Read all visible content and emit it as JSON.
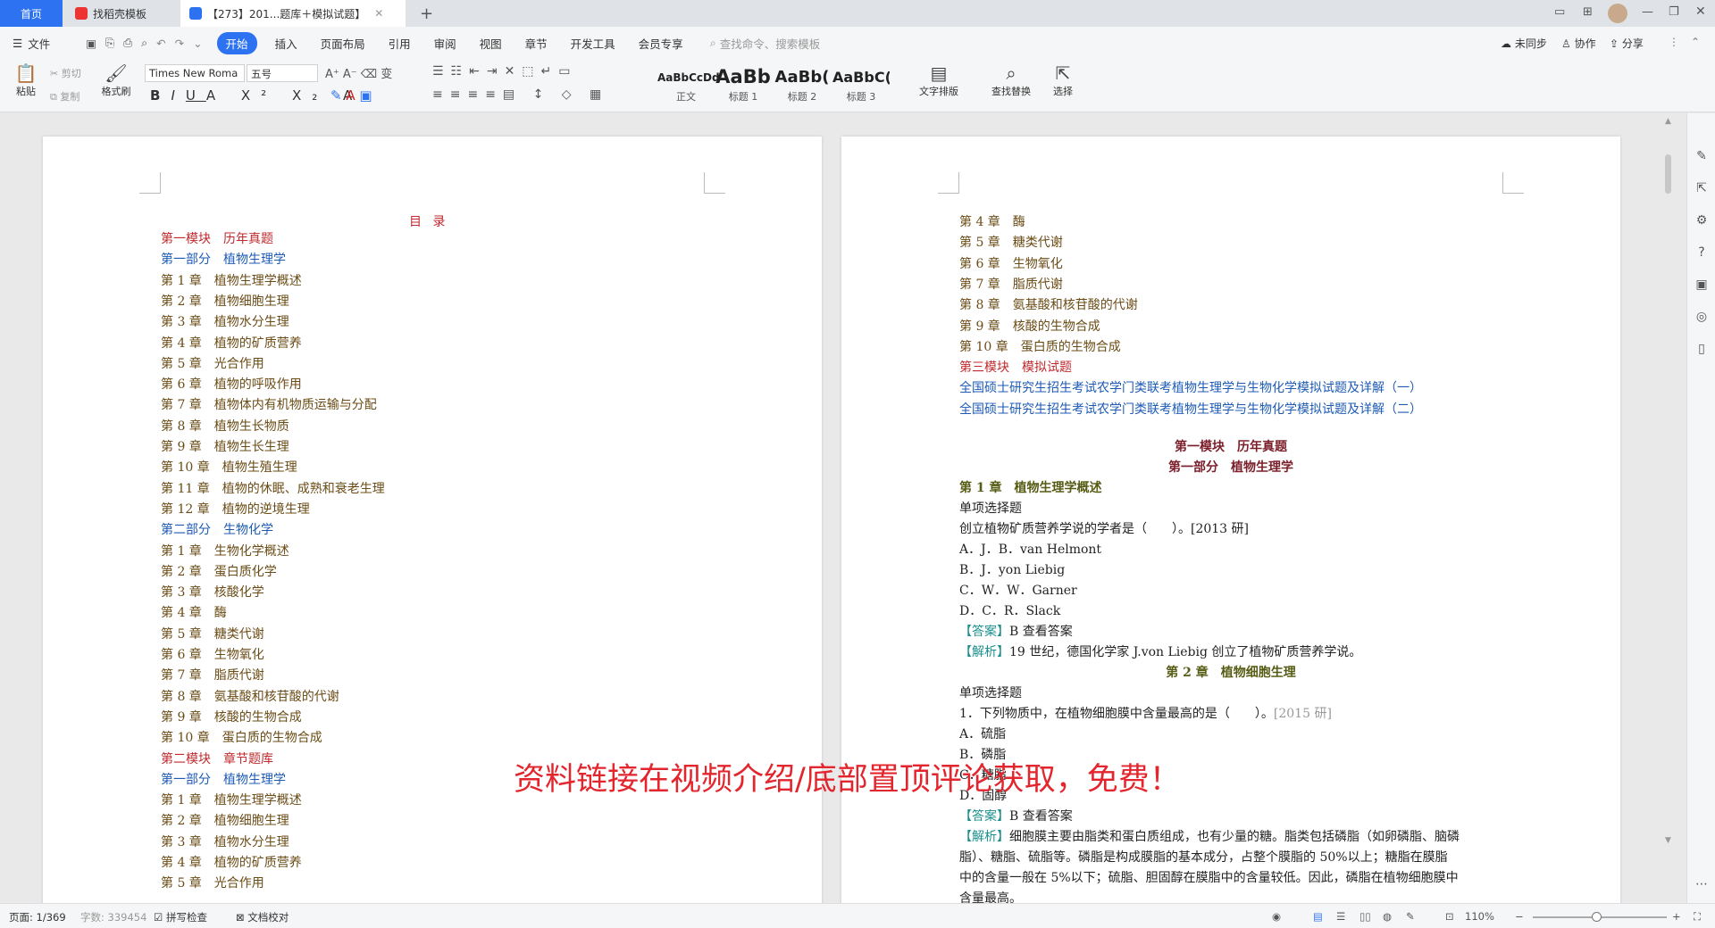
{
  "tabs": {
    "home": "首页",
    "template": "找稻壳模板",
    "doc": "【273】201...题库＋模拟试题】"
  },
  "menu": {
    "file": "文件",
    "items": [
      "开始",
      "插入",
      "页面布局",
      "引用",
      "审阅",
      "视图",
      "章节",
      "开发工具",
      "会员专享"
    ],
    "search": "查找命令、搜索模板",
    "sync": "未同步",
    "collab": "协作",
    "share": "分享"
  },
  "ribbon": {
    "paste": "粘贴",
    "cut": "剪切",
    "copy": "复制",
    "format_painter": "格式刷",
    "font": "Times New Roma",
    "size": "五号",
    "styles": [
      {
        "sample": "AaBbCcDd",
        "label": "正文"
      },
      {
        "sample": "AaBb",
        "label": "标题 1"
      },
      {
        "sample": "AaBb(",
        "label": "标题 2"
      },
      {
        "sample": "AaBbC(",
        "label": "标题 3"
      }
    ],
    "text_layout": "文字排版",
    "find_replace": "查找替换",
    "select": "选择"
  },
  "left_page": {
    "title": "目 录",
    "lines": [
      {
        "t": "第一模块　历年真题",
        "c": "red"
      },
      {
        "t": "第一部分　植物生理学",
        "c": "blue"
      },
      {
        "t": "第 1 章　植物生理学概述",
        "c": "br"
      },
      {
        "t": "第 2 章　植物细胞生理",
        "c": "br"
      },
      {
        "t": "第 3 章　植物水分生理",
        "c": "br"
      },
      {
        "t": "第 4 章　植物的矿质营养",
        "c": "br"
      },
      {
        "t": "第 5 章　光合作用",
        "c": "br"
      },
      {
        "t": "第 6 章　植物的呼吸作用",
        "c": "br"
      },
      {
        "t": "第 7 章　植物体内有机物质运输与分配",
        "c": "br"
      },
      {
        "t": "第 8 章　植物生长物质",
        "c": "br"
      },
      {
        "t": "第 9 章　植物生长生理",
        "c": "br"
      },
      {
        "t": "第 10 章　植物生殖生理",
        "c": "br"
      },
      {
        "t": "第 11 章　植物的休眠、成熟和衰老生理",
        "c": "br"
      },
      {
        "t": "第 12 章　植物的逆境生理",
        "c": "br"
      },
      {
        "t": "第二部分　生物化学",
        "c": "blue"
      },
      {
        "t": "第 1 章　生物化学概述",
        "c": "br"
      },
      {
        "t": "第 2 章　蛋白质化学",
        "c": "br"
      },
      {
        "t": "第 3 章　核酸化学",
        "c": "br"
      },
      {
        "t": "第 4 章　酶",
        "c": "br"
      },
      {
        "t": "第 5 章　糖类代谢",
        "c": "br"
      },
      {
        "t": "第 6 章　生物氧化",
        "c": "br"
      },
      {
        "t": "第 7 章　脂质代谢",
        "c": "br"
      },
      {
        "t": "第 8 章　氨基酸和核苷酸的代谢",
        "c": "br"
      },
      {
        "t": "第 9 章　核酸的生物合成",
        "c": "br"
      },
      {
        "t": "第 10 章　蛋白质的生物合成",
        "c": "br"
      },
      {
        "t": "第二模块　章节题库",
        "c": "red"
      },
      {
        "t": "第一部分　植物生理学",
        "c": "blue"
      },
      {
        "t": "第 1 章　植物生理学概述",
        "c": "br"
      },
      {
        "t": "第 2 章　植物细胞生理",
        "c": "br"
      },
      {
        "t": "第 3 章　植物水分生理",
        "c": "br"
      },
      {
        "t": "第 4 章　植物的矿质营养",
        "c": "br"
      },
      {
        "t": "第 5 章　光合作用",
        "c": "br"
      }
    ]
  },
  "right_page": {
    "toc_lines": [
      {
        "t": "第 4 章　酶",
        "c": "br"
      },
      {
        "t": "第 5 章　糖类代谢",
        "c": "br"
      },
      {
        "t": "第 6 章　生物氧化",
        "c": "br"
      },
      {
        "t": "第 7 章　脂质代谢",
        "c": "br"
      },
      {
        "t": "第 8 章　氨基酸和核苷酸的代谢",
        "c": "br"
      },
      {
        "t": "第 9 章　核酸的生物合成",
        "c": "br"
      },
      {
        "t": "第 10 章　蛋白质的生物合成",
        "c": "br"
      },
      {
        "t": "第三模块　模拟试题",
        "c": "red"
      },
      {
        "t": "全国硕士研究生招生考试农学门类联考植物生理学与生物化学模拟试题及详解（一）",
        "c": "blue"
      },
      {
        "t": "全国硕士研究生招生考试农学门类联考植物生理学与生物化学模拟试题及详解（二）",
        "c": "blue"
      }
    ],
    "module_head": "第一模块　历年真题",
    "part_head": "第一部分　植物生理学",
    "ch1_head": "第 1 章　植物生理学概述",
    "single_choice": "单项选择题",
    "q1": "创立植物矿质营养学说的学者是（　　）。[2013 研]",
    "q1_a": "A．J．B．van Helmont",
    "q1_b": "B．J．yon Liebig",
    "q1_c": "C．W．W．Garner",
    "q1_d": "D．C．R．Slack",
    "q1_ans_tag": "【答案】",
    "q1_ans": "B 查看答案",
    "q1_exp_tag": "【解析】",
    "q1_exp": "19 世纪，德国化学家 J.von Liebig 创立了植物矿质营养学说。",
    "ch2_head": "第 2 章　植物细胞生理",
    "single_choice2": "单项选择题",
    "q2": "1．下列物质中，在植物细胞膜中含量最高的是（　　）。",
    "q2_year": "[2015 研]",
    "q2_a": "A．硫脂",
    "q2_b": "B．磷脂",
    "q2_c": "C．糖脂",
    "q2_d": "D．固醇",
    "q2_ans_tag": "【答案】",
    "q2_ans": "B 查看答案",
    "q2_exp_tag": "【解析】",
    "q2_exp1": "细胞膜主要由脂类和蛋白质组成，也有少量的糖。脂类包括磷脂（如卵磷脂、脑磷",
    "q2_exp2": "脂）、糖脂、硫脂等。磷脂是构成膜脂的基本成分，占整个膜脂的 50%以上；糖脂在膜脂",
    "q2_exp3": "中的含量一般在 5%以下；硫脂、胆固醇在膜脂中的含量较低。因此，磷脂在植物细胞膜中",
    "q2_exp4": "含量最高。"
  },
  "overlay": "资料链接在视频介绍/底部置顶评论获取，免费！",
  "status": {
    "page": "页面: 1/369",
    "words": "字数: 339454",
    "spell": "拼写检查",
    "proof": "文档校对",
    "zoom": "110%"
  }
}
